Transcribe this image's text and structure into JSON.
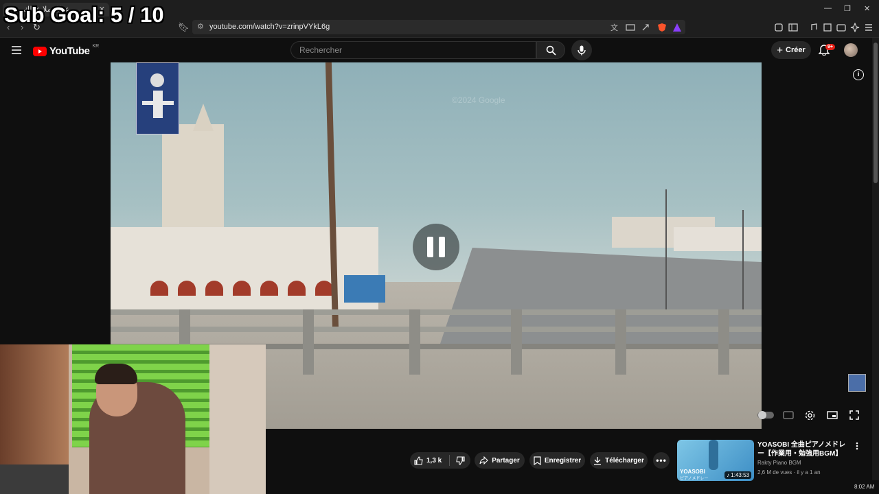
{
  "overlay": {
    "sub_goal": "Sub Goal: 5 / 10"
  },
  "browser": {
    "tab_title": "عظل ملا عدلك",
    "url": "youtube.com/watch?v=zrinpVYkL6g"
  },
  "youtube": {
    "logo_text": "YouTube",
    "region": "KR",
    "search_placeholder": "Rechercher",
    "create_label": "Créer",
    "notification_count": "9+"
  },
  "video": {
    "state": "paused-overlay",
    "watermark": "©2024 Google"
  },
  "actions": {
    "likes": "1,3 k",
    "share_label": "Partager",
    "save_label": "Enregistrer",
    "download_label": "Télécharger"
  },
  "recommendation": {
    "title": "YOASOBI 全曲ピアノメドレー【作業用・勉強用BGM】",
    "channel": "Rakty Piano BGM",
    "meta": "2,6 M de vues · il y a 1 an",
    "duration": "1:43:53",
    "thumb_brand": "YOASOBI",
    "thumb_sub": "ピアノメドレー"
  },
  "system": {
    "clock": "8:02 AM"
  },
  "colors": {
    "youtube_red": "#ff0000",
    "bg": "#0f0f0f",
    "badge": "#e62117"
  }
}
